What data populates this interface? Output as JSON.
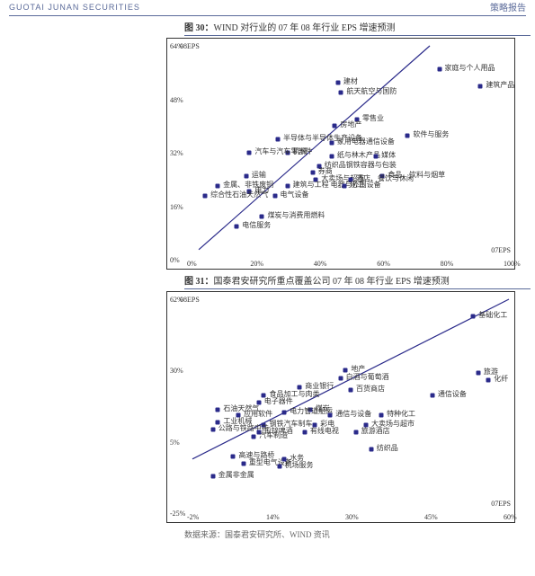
{
  "header": {
    "brand": "GUOTAI JUNAN SECURITIES",
    "doc_type": "策略报告"
  },
  "chart_data": [
    {
      "type": "scatter",
      "fig_no": "图 30：",
      "title": "WIND 对行业的 07 年 08 年行业 EPS 增速预测",
      "xlabel": "07EPS",
      "ylabel": "08EPS",
      "xlim": [
        0,
        100
      ],
      "ylim": [
        0,
        64
      ],
      "xticks": [
        "0%",
        "20%",
        "40%",
        "60%",
        "80%",
        "100%"
      ],
      "yticks": [
        "0%",
        "16%",
        "32%",
        "48%",
        "64%"
      ],
      "trendline": {
        "x0": 2,
        "y0": 3,
        "x1": 75,
        "y1": 64
      },
      "points": [
        {
          "x": 78,
          "y": 57,
          "label": "家庭与个人用品"
        },
        {
          "x": 46,
          "y": 53,
          "label": "建材"
        },
        {
          "x": 91,
          "y": 52,
          "label": "建筑产品"
        },
        {
          "x": 47,
          "y": 50,
          "label": "航天航空与国防"
        },
        {
          "x": 52,
          "y": 42,
          "label": "零售业"
        },
        {
          "x": 45,
          "y": 40,
          "label": "房地产"
        },
        {
          "x": 27,
          "y": 36,
          "label": "半导体与半导体生产设备"
        },
        {
          "x": 44,
          "y": 35,
          "label": "家用电器通信设备"
        },
        {
          "x": 68,
          "y": 37,
          "label": "软件与服务"
        },
        {
          "x": 30,
          "y": 32,
          "label": "机械"
        },
        {
          "x": 18,
          "y": 32,
          "label": "汽车与汽车零部件"
        },
        {
          "x": 44,
          "y": 31,
          "label": "纸与林木产品"
        },
        {
          "x": 58,
          "y": 31,
          "label": "媒体"
        },
        {
          "x": 40,
          "y": 28,
          "label": "纺织品钢铁容器与包装"
        },
        {
          "x": 38,
          "y": 26,
          "label": "券商"
        },
        {
          "x": 17,
          "y": 25,
          "label": "运输"
        },
        {
          "x": 60,
          "y": 25,
          "label": "食品、饮料与烟草"
        },
        {
          "x": 39,
          "y": 24,
          "label": "大卖场与超市"
        },
        {
          "x": 50,
          "y": 24,
          "label": "酒店、餐饮与休闲"
        },
        {
          "x": 8,
          "y": 22,
          "label": "金属、非铁废铜"
        },
        {
          "x": 30,
          "y": 22,
          "label": "建筑与工程 电器与外围设备"
        },
        {
          "x": 48,
          "y": 22,
          "label": "化工"
        },
        {
          "x": 18,
          "y": 20.5,
          "label": "电力"
        },
        {
          "x": 4,
          "y": 19,
          "label": "综合性石油天然气"
        },
        {
          "x": 26,
          "y": 19,
          "label": "电气设备"
        },
        {
          "x": 22,
          "y": 13,
          "label": "煤炭与消费用燃料"
        },
        {
          "x": 14,
          "y": 10,
          "label": "电信服务"
        }
      ]
    },
    {
      "type": "scatter",
      "fig_no": "图 31：",
      "title": "国泰君安研究所重点覆盖公司 07 年 08 年行业 EPS 增速预测",
      "xlabel": "07EPS",
      "ylabel": "08EPS",
      "xlim": [
        -2,
        60
      ],
      "ylim": [
        -25,
        62
      ],
      "xticks": [
        "-2%",
        "14%",
        "30%",
        "45%",
        "60%"
      ],
      "yticks": [
        "-25%",
        "5%",
        "30%",
        "62%"
      ],
      "trendline": {
        "x0": -2,
        "y0": -3,
        "x1": 60,
        "y1": 62
      },
      "points": [
        {
          "x": 53,
          "y": 55,
          "label": "基础化工"
        },
        {
          "x": 28,
          "y": 33,
          "label": "地产"
        },
        {
          "x": 54,
          "y": 32,
          "label": "旅游"
        },
        {
          "x": 27,
          "y": 30,
          "label": "白酒与葡萄酒"
        },
        {
          "x": 56,
          "y": 29,
          "label": "化纤"
        },
        {
          "x": 19,
          "y": 26,
          "label": "商业银行"
        },
        {
          "x": 29,
          "y": 25,
          "label": "百货商店"
        },
        {
          "x": 12,
          "y": 23,
          "label": "食品加工与肉类"
        },
        {
          "x": 45,
          "y": 23,
          "label": "通信设备"
        },
        {
          "x": 11,
          "y": 20,
          "label": "电子器件"
        },
        {
          "x": 3,
          "y": 17,
          "label": "石油天然气"
        },
        {
          "x": 21,
          "y": 17,
          "label": "煤炭"
        },
        {
          "x": 7,
          "y": 15,
          "label": "应用软件"
        },
        {
          "x": 16,
          "y": 16,
          "label": "电力管道船运"
        },
        {
          "x": 25,
          "y": 15,
          "label": "通信与设备"
        },
        {
          "x": 35,
          "y": 15,
          "label": "特种化工"
        },
        {
          "x": 3,
          "y": 12,
          "label": "工业机械"
        },
        {
          "x": 12,
          "y": 11,
          "label": "钢铁汽车制车"
        },
        {
          "x": 22,
          "y": 11,
          "label": "彩电"
        },
        {
          "x": 32,
          "y": 11,
          "label": "大卖场与超市"
        },
        {
          "x": 2,
          "y": 9,
          "label": "公路与铁路中药"
        },
        {
          "x": 11,
          "y": 8,
          "label": "铅锌啤酒"
        },
        {
          "x": 20,
          "y": 8,
          "label": "有线电视"
        },
        {
          "x": 30,
          "y": 8,
          "label": "旅游酒店"
        },
        {
          "x": 10,
          "y": 6,
          "label": "汽车制造"
        },
        {
          "x": 33,
          "y": 1,
          "label": "纺织品"
        },
        {
          "x": 6,
          "y": -2,
          "label": "高速与路桥"
        },
        {
          "x": 8,
          "y": -5,
          "label": "重型电气设备"
        },
        {
          "x": 16,
          "y": -3,
          "label": "水务"
        },
        {
          "x": 15,
          "y": -6,
          "label": "机场服务"
        },
        {
          "x": 2,
          "y": -10,
          "label": "金属非金属"
        }
      ]
    }
  ],
  "source": "数据来源：国泰君安研究所、WIND 资讯"
}
